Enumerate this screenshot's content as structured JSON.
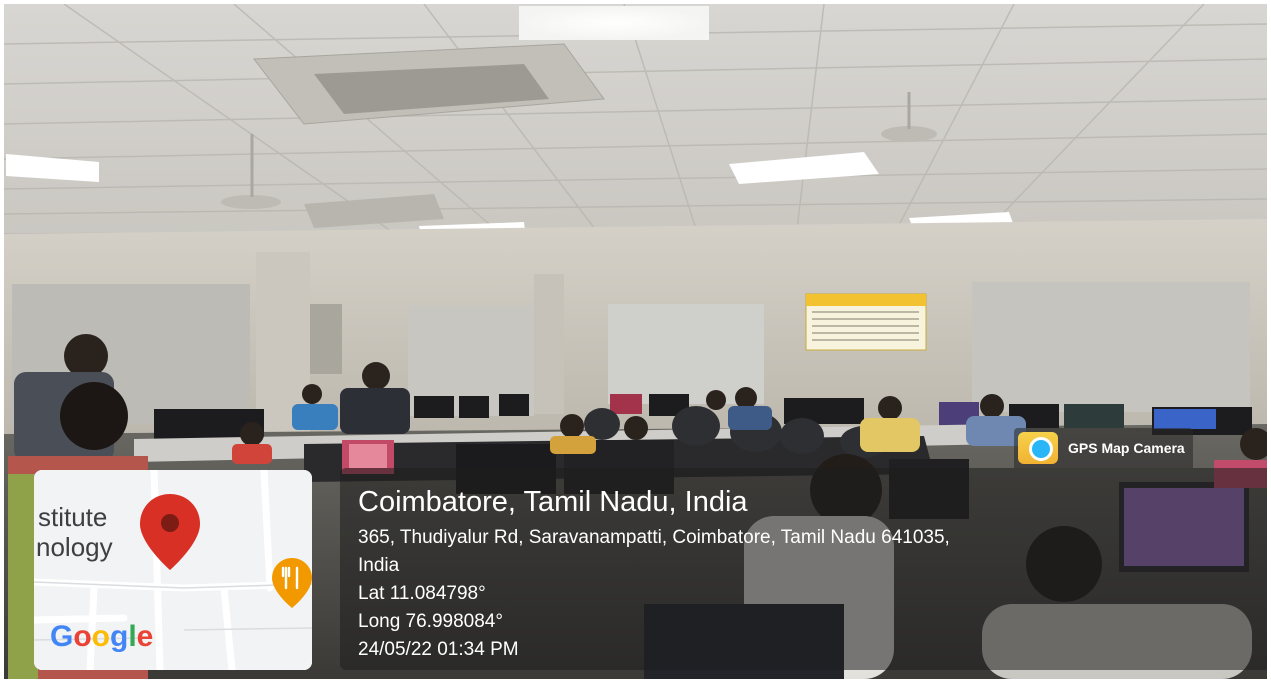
{
  "overlay": {
    "brand": "GPS Map Camera",
    "location_title": "Coimbatore, Tamil Nadu, India",
    "address_line_1": "365, Thudiyalur Rd, Saravanampatti, Coimbatore, Tamil Nadu 641035,",
    "address_line_2": "India",
    "latitude": "Lat 11.084798°",
    "longitude": "Long 76.998084°",
    "datetime": "24/05/22 01:34 PM"
  },
  "map": {
    "label_1": "stitute",
    "label_2": "nology",
    "provider": "Google",
    "pin_color": "#d93025",
    "poi_color": "#f29900"
  },
  "icons": {
    "gps_logo": "gps-map-camera-icon",
    "pin": "map-pin-icon",
    "restaurant": "restaurant-poi-icon"
  }
}
